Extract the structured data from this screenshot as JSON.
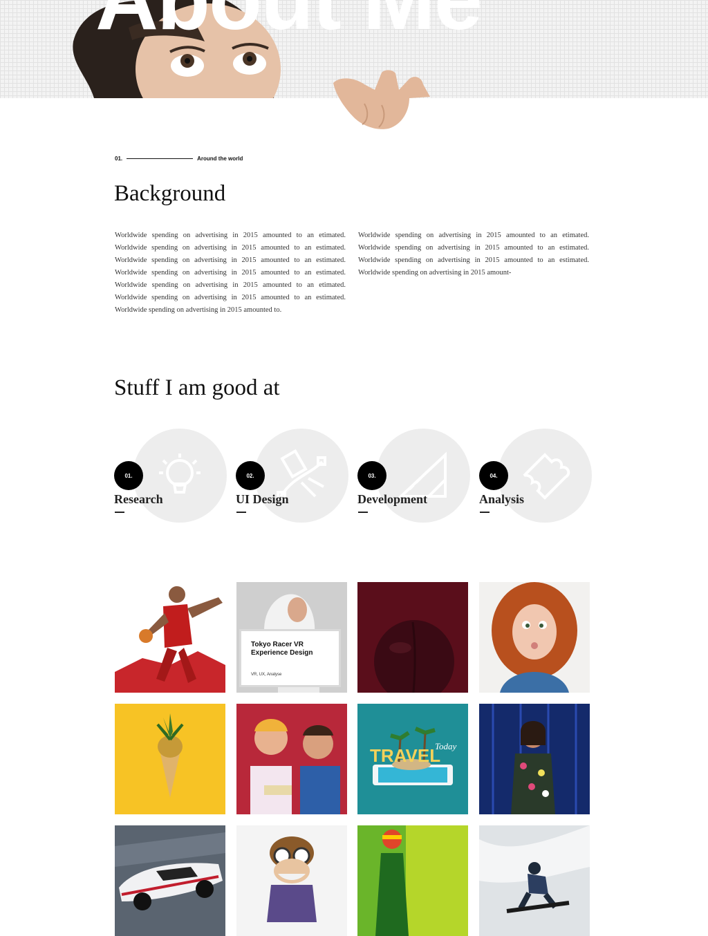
{
  "hero": {
    "title": "About Me"
  },
  "background": {
    "eyebrow_number": "01.",
    "eyebrow_label": "Around the world",
    "title": "Background",
    "col_left": "Worldwide spending on advertising in 2015 amounted to an etimated. Worldwide spending on advertising in 2015 amounted to an estimated. Worldwide spending on advertising in 2015 amounted to an estimated. Worldwide spending on advertising in 2015 amounted to an estimated. Worldwide spending on advertising in 2015 amounted to an etimated. Worldwide spending on advertising in 2015 amounted to an estimated. Worldwide spending on advertising in 2015 amounted to.",
    "col_right": "Worldwide spending on advertising in 2015 amounted to an etimated. Worldwide spending on advertising in 2015 amounted to an estimated. Worldwide spending on advertising in 2015 amounted to an estimated. Worldwide spending on advertising in 2015 amount-"
  },
  "skills": {
    "title": "Stuff I am good at",
    "items": [
      {
        "number": "01.",
        "label": "Research",
        "icon": "lightbulb-icon"
      },
      {
        "number": "02.",
        "label": "UI Design",
        "icon": "vector-pen-icon"
      },
      {
        "number": "03.",
        "label": "Development",
        "icon": "ruler-triangle-icon"
      },
      {
        "number": "04.",
        "label": "Analysis",
        "icon": "puzzle-icon"
      }
    ]
  },
  "portfolio": {
    "featured_card": {
      "title": "Tokyo Racer VR Experience Design",
      "tags": "VR, UX, Analyse"
    },
    "tile_image_text": "TRAVEL",
    "tile_image_script": "Today"
  }
}
